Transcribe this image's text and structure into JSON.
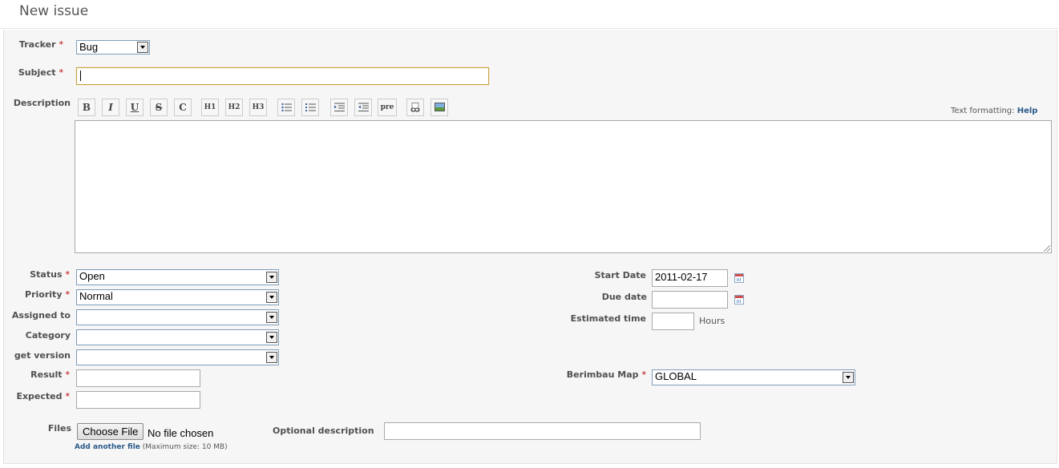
{
  "page_title": "New issue",
  "form": {
    "tracker": {
      "label": "Tracker",
      "value": "Bug"
    },
    "subject": {
      "label": "Subject",
      "value": ""
    },
    "description": {
      "label": "Description"
    },
    "toolbar": {
      "bold": "B",
      "italic": "I",
      "underline": "U",
      "strike": "S",
      "code": "C",
      "h1": "H1",
      "h2": "H2",
      "h3": "H3",
      "pre": "pre",
      "buttons": [
        "bold-icon",
        "italic-icon",
        "underline-icon",
        "strikethrough-icon",
        "code-icon",
        "heading1-icon",
        "heading2-icon",
        "heading3-icon",
        "unordered-list-icon",
        "ordered-list-icon",
        "indent-icon",
        "outdent-icon",
        "pre-icon",
        "link-icon",
        "image-icon"
      ]
    },
    "text_formatting": {
      "label": "Text formatting:",
      "help": "Help"
    },
    "status": {
      "label": "Status",
      "value": "Open"
    },
    "priority": {
      "label": "Priority",
      "value": "Normal"
    },
    "assigned_to": {
      "label": "Assigned to",
      "value": ""
    },
    "category": {
      "label": "Category",
      "value": ""
    },
    "target_version": {
      "label": "get version",
      "value": ""
    },
    "result": {
      "label": "Result",
      "value": ""
    },
    "expected": {
      "label": "Expected",
      "value": ""
    },
    "start_date": {
      "label": "Start Date",
      "value": "2011-02-17"
    },
    "due_date": {
      "label": "Due date",
      "value": ""
    },
    "estimated_time": {
      "label": "Estimated time",
      "value": "",
      "unit": "Hours"
    },
    "berimbau_map": {
      "label": "Berimbau Map",
      "value": "GLOBAL"
    },
    "files": {
      "label": "Files",
      "choose_button": "Choose File",
      "no_file_text": "No file chosen",
      "optional_description_label": "Optional description",
      "add_another": "Add another file",
      "max_size": "(Maximum size: 10 MB)"
    },
    "required_marker": "*"
  }
}
